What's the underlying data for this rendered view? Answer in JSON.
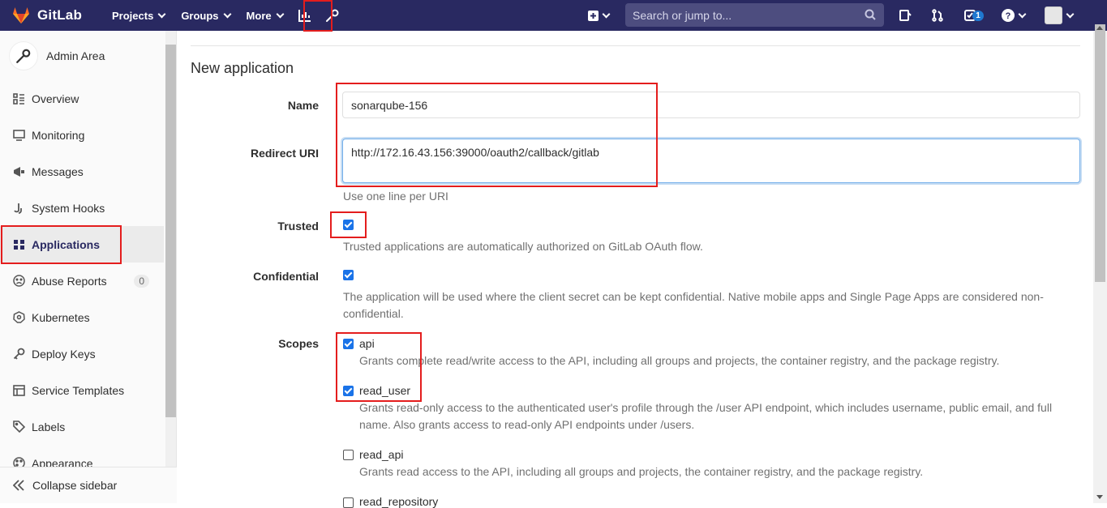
{
  "navbar": {
    "brand": "GitLab",
    "projects": "Projects",
    "groups": "Groups",
    "more": "More",
    "search_placeholder": "Search or jump to...",
    "todos_count": "1"
  },
  "sidebar": {
    "title": "Admin Area",
    "items": [
      {
        "label": "Overview",
        "icon": "overview-icon"
      },
      {
        "label": "Monitoring",
        "icon": "monitor-icon"
      },
      {
        "label": "Messages",
        "icon": "messages-icon"
      },
      {
        "label": "System Hooks",
        "icon": "hook-icon"
      },
      {
        "label": "Applications",
        "icon": "applications-icon",
        "active": true
      },
      {
        "label": "Abuse Reports",
        "icon": "abuse-icon",
        "count": "0"
      },
      {
        "label": "Kubernetes",
        "icon": "kubernetes-icon"
      },
      {
        "label": "Deploy Keys",
        "icon": "key-icon"
      },
      {
        "label": "Service Templates",
        "icon": "template-icon"
      },
      {
        "label": "Labels",
        "icon": "label-icon"
      },
      {
        "label": "Appearance",
        "icon": "appearance-icon"
      }
    ],
    "collapse": "Collapse sidebar"
  },
  "form": {
    "page_title": "New application",
    "name_label": "Name",
    "name_value": "sonarqube-156",
    "redirect_label": "Redirect URI",
    "redirect_value": "http://172.16.43.156:39000/oauth2/callback/gitlab",
    "redirect_help": "Use one line per URI",
    "trusted_label": "Trusted",
    "trusted_checked": true,
    "trusted_help": "Trusted applications are automatically authorized on GitLab OAuth flow.",
    "confidential_label": "Confidential",
    "confidential_checked": true,
    "confidential_help_1": "The application will be used where the client secret can be kept confidential. Native mobile apps and Single Page Apps are considered non-",
    "confidential_help_2": "confidential.",
    "scopes_label": "Scopes",
    "scopes": [
      {
        "name": "api",
        "checked": true,
        "help_1": "Grants complete read/write access to the API, including all groups and projects, the container registry, and the package registry.",
        "help_2": ""
      },
      {
        "name": "read_user",
        "checked": true,
        "help_1": "Grants read-only access to the authenticated user's profile through the /user API endpoint, which includes username, public email, and full",
        "help_2": "name. Also grants access to read-only API endpoints under /users."
      },
      {
        "name": "read_api",
        "checked": false,
        "help_1": "Grants read access to the API, including all groups and projects, the container registry, and the package registry.",
        "help_2": ""
      },
      {
        "name": "read_repository",
        "checked": false,
        "help_1": "",
        "help_2": ""
      }
    ]
  },
  "colors": {
    "navbar": "#292961",
    "accent": "#1a73e8",
    "annotation": "#e41d1d"
  }
}
